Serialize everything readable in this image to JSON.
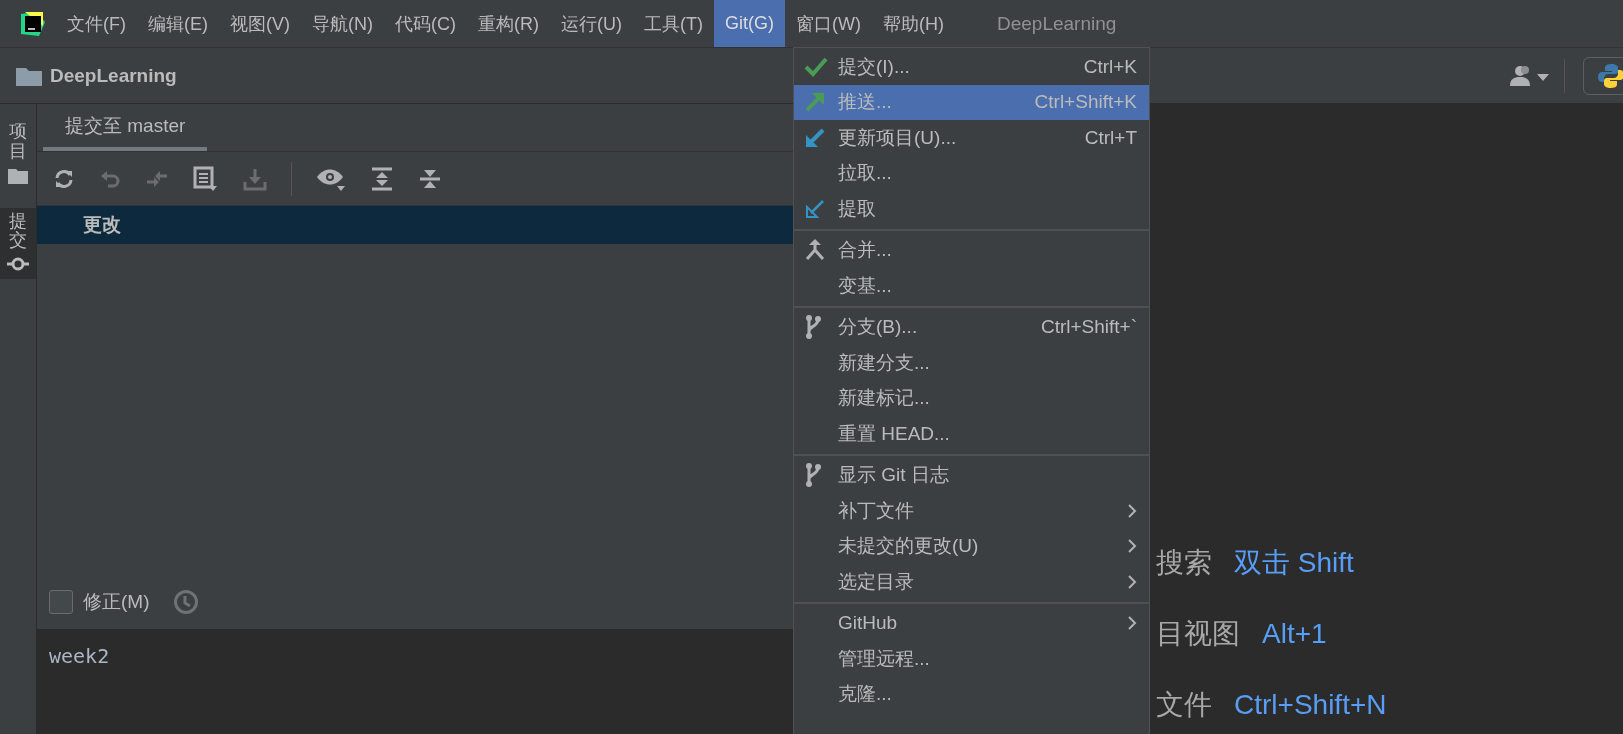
{
  "window": {
    "title": "DeepLearning"
  },
  "menu_bar": [
    {
      "label": "文件(F)",
      "selected": false
    },
    {
      "label": "编辑(E)",
      "selected": false
    },
    {
      "label": "视图(V)",
      "selected": false
    },
    {
      "label": "导航(N)",
      "selected": false
    },
    {
      "label": "代码(C)",
      "selected": false
    },
    {
      "label": "重构(R)",
      "selected": false
    },
    {
      "label": "运行(U)",
      "selected": false
    },
    {
      "label": "工具(T)",
      "selected": false
    },
    {
      "label": "Git(G)",
      "selected": true
    },
    {
      "label": "窗口(W)",
      "selected": false
    },
    {
      "label": "帮助(H)",
      "selected": false
    }
  ],
  "nav_bar": {
    "project": "DeepLearning"
  },
  "tool_strip": [
    {
      "label": "项目",
      "selected": false
    },
    {
      "label": "提交",
      "selected": true
    }
  ],
  "commit_panel": {
    "tab": "提交至 master",
    "toolbar": [
      {
        "kind": "refresh",
        "disabled": false
      },
      {
        "kind": "undo",
        "disabled": true
      },
      {
        "kind": "rollback",
        "disabled": true
      },
      {
        "kind": "diff",
        "disabled": false
      },
      {
        "kind": "shelve",
        "disabled": true
      },
      {
        "kind": "sep"
      },
      {
        "kind": "eye",
        "disabled": false
      },
      {
        "kind": "expand",
        "disabled": false
      },
      {
        "kind": "collapse",
        "disabled": false
      }
    ],
    "changes": [
      {
        "label": "更改",
        "selected": true
      }
    ],
    "amend": {
      "label": "修正(M)",
      "checked": false
    },
    "message": "week2"
  },
  "editor_hints": [
    {
      "label": "搜索",
      "shortcut": "双击 Shift"
    },
    {
      "label": "目视图",
      "shortcut": "Alt+1"
    },
    {
      "label": "文件",
      "shortcut": "Ctrl+Shift+N"
    }
  ],
  "git_menu": {
    "groups": [
      [
        {
          "kind": "check",
          "label": "提交(I)...",
          "shortcut": "Ctrl+K",
          "submenu": false,
          "selected": false
        },
        {
          "kind": "push",
          "label": "推送...",
          "shortcut": "Ctrl+Shift+K",
          "submenu": false,
          "selected": true
        },
        {
          "kind": "update",
          "label": "更新项目(U)...",
          "shortcut": "Ctrl+T",
          "submenu": false,
          "selected": false
        },
        {
          "kind": "plain",
          "label": "拉取...",
          "submenu": false,
          "selected": false
        },
        {
          "kind": "fetch",
          "label": "提取",
          "submenu": false,
          "selected": false
        }
      ],
      [
        {
          "kind": "merge",
          "label": "合并...",
          "submenu": false,
          "selected": false
        },
        {
          "kind": "plain",
          "label": "变基...",
          "submenu": false,
          "selected": false
        }
      ],
      [
        {
          "kind": "branch",
          "label": "分支(B)...",
          "shortcut": "Ctrl+Shift+`",
          "submenu": false,
          "selected": false
        },
        {
          "kind": "plain",
          "label": "新建分支...",
          "submenu": false,
          "selected": false
        },
        {
          "kind": "plain",
          "label": "新建标记...",
          "submenu": false,
          "selected": false
        },
        {
          "kind": "plain",
          "label": "重置 HEAD...",
          "submenu": false,
          "selected": false
        }
      ],
      [
        {
          "kind": "branch",
          "label": "显示 Git 日志",
          "submenu": false,
          "selected": false
        },
        {
          "kind": "plain",
          "label": "补丁文件",
          "submenu": true,
          "selected": false
        },
        {
          "kind": "plain",
          "label": "未提交的更改(U)",
          "submenu": true,
          "selected": false
        },
        {
          "kind": "plain",
          "label": "选定目录",
          "submenu": true,
          "selected": false
        }
      ],
      [
        {
          "kind": "plain",
          "label": "GitHub",
          "submenu": true,
          "selected": false
        },
        {
          "kind": "plain",
          "label": "管理远程...",
          "submenu": false,
          "selected": false
        },
        {
          "kind": "plain",
          "label": "克隆...",
          "submenu": false,
          "selected": false
        }
      ]
    ]
  }
}
